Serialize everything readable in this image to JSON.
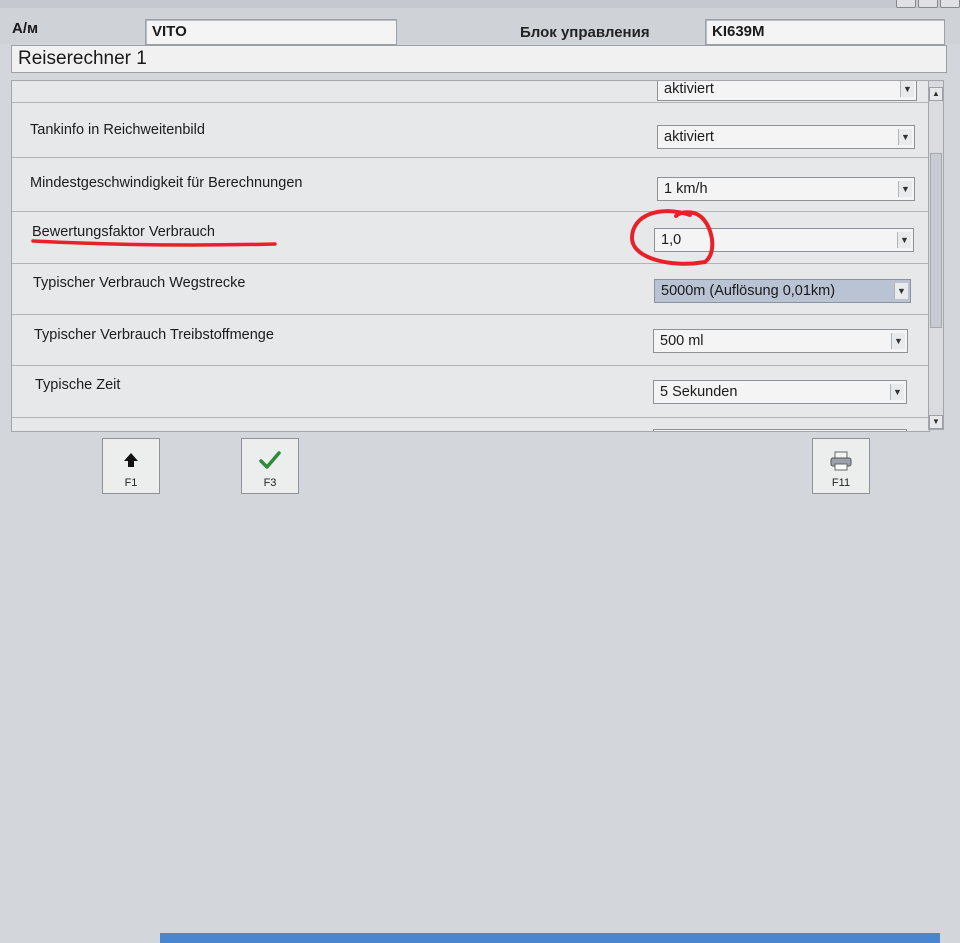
{
  "header": {
    "am_label": "А/м",
    "vehicle_value": "VITO",
    "control_unit_label": "Блок управления",
    "control_unit_value": "KI639M"
  },
  "title": "Reiserechner 1",
  "rows": [
    {
      "label": "",
      "value": "aktiviert"
    },
    {
      "label": "Tankinfo in Reichweitenbild",
      "value": "aktiviert"
    },
    {
      "label": "Mindestgeschwindigkeit für Berechnungen",
      "value": "1 km/h"
    },
    {
      "label": "Bewertungsfaktor Verbrauch",
      "value": "1,0"
    },
    {
      "label": "Typischer Verbrauch Wegstrecke",
      "value": "5000m (Auflösung 0,01km)"
    },
    {
      "label": "Typischer Verbrauch Treibstoffmenge",
      "value": "500 ml"
    },
    {
      "label": "Typische Zeit",
      "value": "5 Sekunden"
    }
  ],
  "fkeys": [
    {
      "label": "F1",
      "icon": "arrow-up-icon"
    },
    {
      "label": "F3",
      "icon": "checkmark-icon"
    },
    {
      "label": "F11",
      "icon": "printer-icon"
    }
  ],
  "colors": {
    "annotation_red": "#e8202a",
    "selected_dropdown": "#b9c3d3",
    "taskbar_blue": "#4a86cf"
  }
}
